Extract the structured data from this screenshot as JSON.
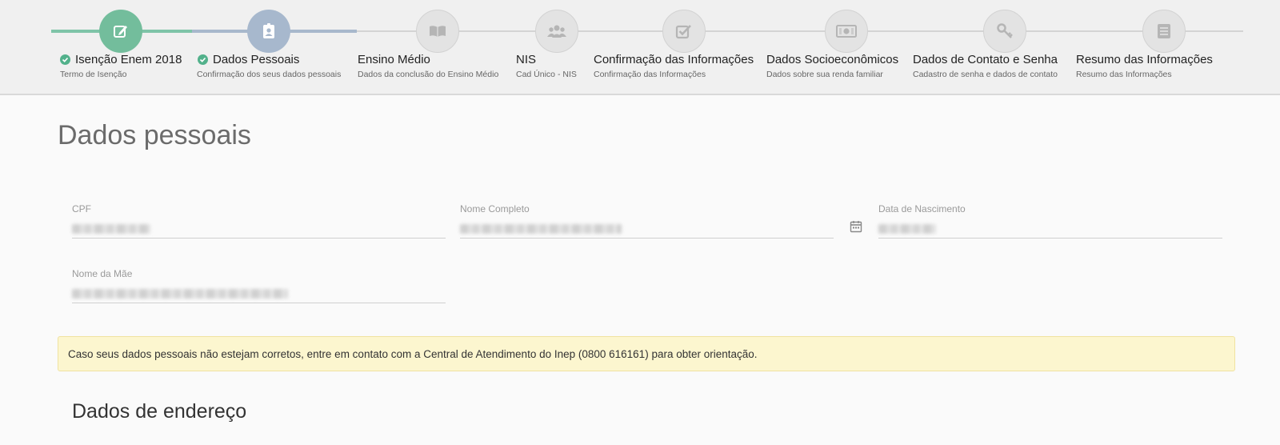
{
  "stepper": {
    "steps": [
      {
        "title": "Isenção Enem 2018",
        "subtitle": "Termo de Isenção",
        "state": "done",
        "icon": "pencil-square-icon"
      },
      {
        "title": "Dados Pessoais",
        "subtitle": "Confirmação dos seus dados pessoais",
        "state": "current",
        "icon": "id-badge-icon"
      },
      {
        "title": "Ensino Médio",
        "subtitle": "Dados da conclusão do Ensino Médio",
        "state": "pending",
        "icon": "book-icon"
      },
      {
        "title": "NIS",
        "subtitle": "Cad Único - NIS",
        "state": "pending",
        "icon": "users-icon"
      },
      {
        "title": "Confirmação das Informações",
        "subtitle": "Confirmação das Informações",
        "state": "pending",
        "icon": "check-square-icon"
      },
      {
        "title": "Dados Socioeconômicos",
        "subtitle": "Dados sobre sua renda familiar",
        "state": "pending",
        "icon": "money-icon"
      },
      {
        "title": "Dados de Contato e Senha",
        "subtitle": "Cadastro de senha e dados de contato",
        "state": "pending",
        "icon": "key-icon"
      },
      {
        "title": "Resumo das Informações",
        "subtitle": "Resumo das Informações",
        "state": "pending",
        "icon": "list-icon"
      }
    ],
    "colors": {
      "done": "#73bd9c",
      "current": "#a7b8cd",
      "pending": "#e3e3e3"
    }
  },
  "page": {
    "title": "Dados pessoais"
  },
  "form": {
    "cpf_label": "CPF",
    "nome_label": "Nome Completo",
    "nascimento_label": "Data de Nascimento",
    "mae_label": "Nome da Mãe",
    "values_obscured": true,
    "calendar_icon": "calendar-icon"
  },
  "alert": {
    "text": "Caso seus dados pessoais não estejam corretos, entre em contato com a Central de Atendimento do Inep (0800 616161) para obter orientação.",
    "color": "#fcf6cf"
  },
  "address": {
    "title": "Dados de endereço"
  }
}
